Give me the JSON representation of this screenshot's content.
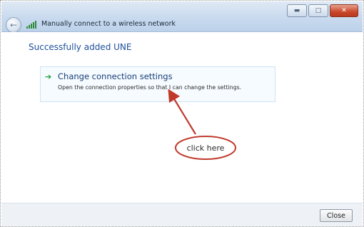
{
  "window": {
    "title": "Manually connect to a wireless network",
    "controls": [
      "minimize",
      "maximize",
      "close"
    ]
  },
  "content": {
    "heading": "Successfully added UNE",
    "task": {
      "icon": "green-arrow-icon",
      "title": "Change connection settings",
      "description": "Open the connection properties so that I can change the settings."
    }
  },
  "annotation": {
    "callout_text": "click here",
    "color": "#c0392b"
  },
  "footer": {
    "close_label": "Close"
  }
}
